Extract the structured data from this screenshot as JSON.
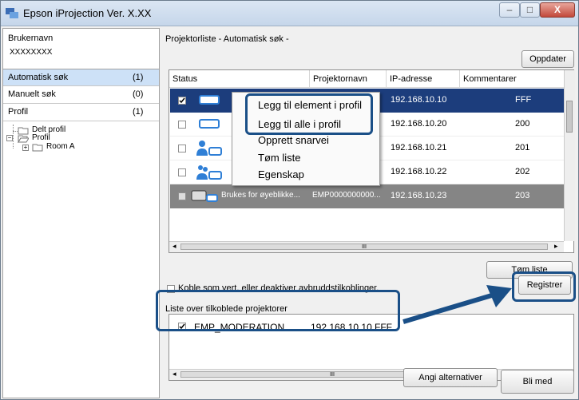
{
  "window": {
    "title": "Epson iProjection Ver. X.XX",
    "min_glyph": "–",
    "max_glyph": "□",
    "close_glyph": "X"
  },
  "sidebar": {
    "username_label": "Brukernavn",
    "username_value": "XXXXXXXX",
    "nav": [
      {
        "label": "Automatisk søk",
        "count": "(1)"
      },
      {
        "label": "Manuelt søk",
        "count": "(0)"
      },
      {
        "label": "Profil",
        "count": "(1)"
      }
    ],
    "tree": [
      "Delt profil",
      "Profil",
      "Room A"
    ]
  },
  "projector_list": {
    "title": "Projektorliste - Automatisk søk -",
    "update_button": "Oppdater",
    "columns": [
      "Status",
      "Projektornavn",
      "IP-adresse",
      "Kommentarer"
    ],
    "rows": [
      {
        "name": "",
        "ip": "192.168.10.10",
        "comment": "FFF"
      },
      {
        "name": "",
        "ip": "192.168.10.20",
        "comment": "200"
      },
      {
        "name": "",
        "ip": "192.168.10.21",
        "comment": "201"
      },
      {
        "name": "",
        "ip": "192.168.10.22",
        "comment": "202"
      },
      {
        "name": "EMP0000000000...",
        "status_text": "Brukes for øyeblikke...",
        "ip": "192.168.10.23",
        "comment": "203"
      }
    ],
    "scroll_glyph": "III",
    "clear_button": "Tøm liste"
  },
  "context_menu": {
    "items": [
      "Legg til element i profil",
      "Legg til alle i profil",
      "Opprett snarvei",
      "Tøm liste",
      "Egenskap"
    ]
  },
  "host_option_label": "Koble som vert, eller deaktiver avbruddstilkoblinger.",
  "connected": {
    "title": "Liste over tilkoblede projektorer",
    "register_button": "Registrer",
    "rows": [
      {
        "name": "EMP_MODERATION",
        "ip": "192.168.10.10",
        "comment": "FFF"
      }
    ]
  },
  "footer": {
    "options_button": "Angi alternativer",
    "join_button": "Bli med"
  },
  "colors": {
    "highlight": "#1a4f87",
    "selected_row": "#1c3d7c",
    "accent": "#2f7fd6"
  }
}
